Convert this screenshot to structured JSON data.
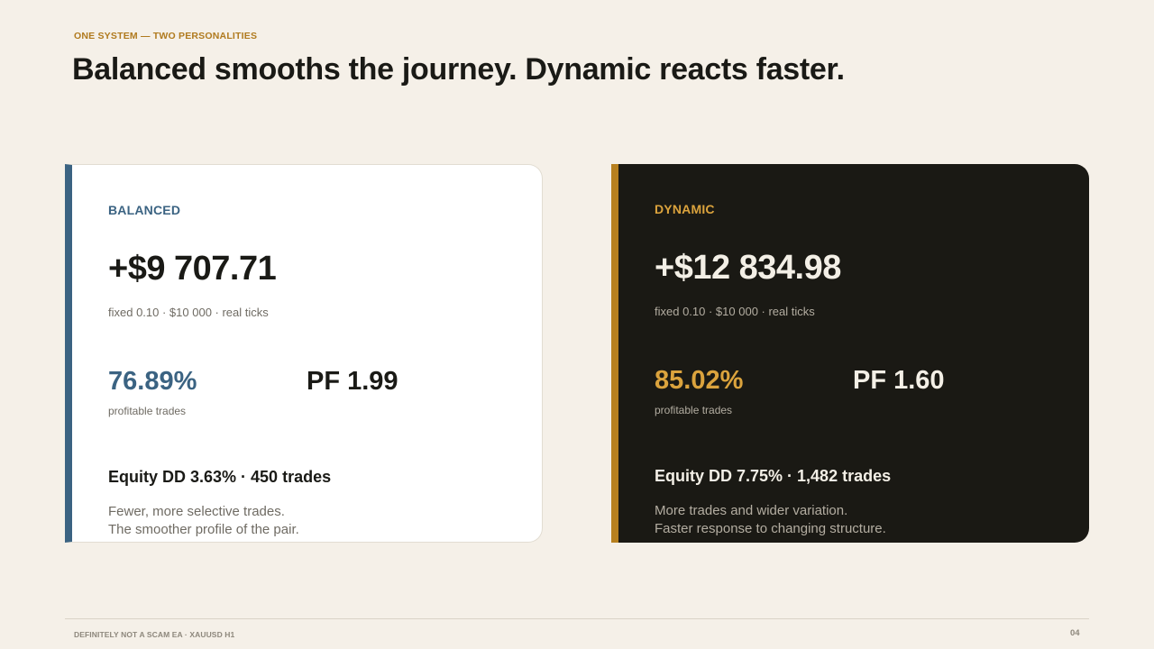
{
  "header": {
    "eyebrow": "ONE SYSTEM — TWO PERSONALITIES",
    "title": "Balanced smooths the journey. Dynamic reacts faster."
  },
  "cards": [
    {
      "label": "BALANCED",
      "amount": "+$9 707.71",
      "subtitle": "fixed 0.10 · $10 000 · real ticks",
      "win_rate": "76.89%",
      "win_rate_label": "profitable trades",
      "profit_factor": "PF 1.99",
      "equity_summary": "Equity DD 3.63% · 450 trades",
      "description": [
        "Fewer, more selective trades.",
        "The smoother profile of the pair."
      ],
      "accent_color": "#3b6382"
    },
    {
      "label": "DYNAMIC",
      "amount": "+$12 834.98",
      "subtitle": "fixed 0.10 · $10 000 · real ticks",
      "win_rate": "85.02%",
      "win_rate_label": "profitable trades",
      "profit_factor": "PF 1.60",
      "equity_summary": "Equity DD 7.75% · 1,482 trades",
      "description": [
        "More trades and wider variation.",
        "Faster response to changing structure."
      ],
      "accent_color": "#b7801f"
    }
  ],
  "footer": {
    "left": "DEFINITELY NOT A SCAM EA · XAUUSD H1",
    "page_number": "04"
  }
}
